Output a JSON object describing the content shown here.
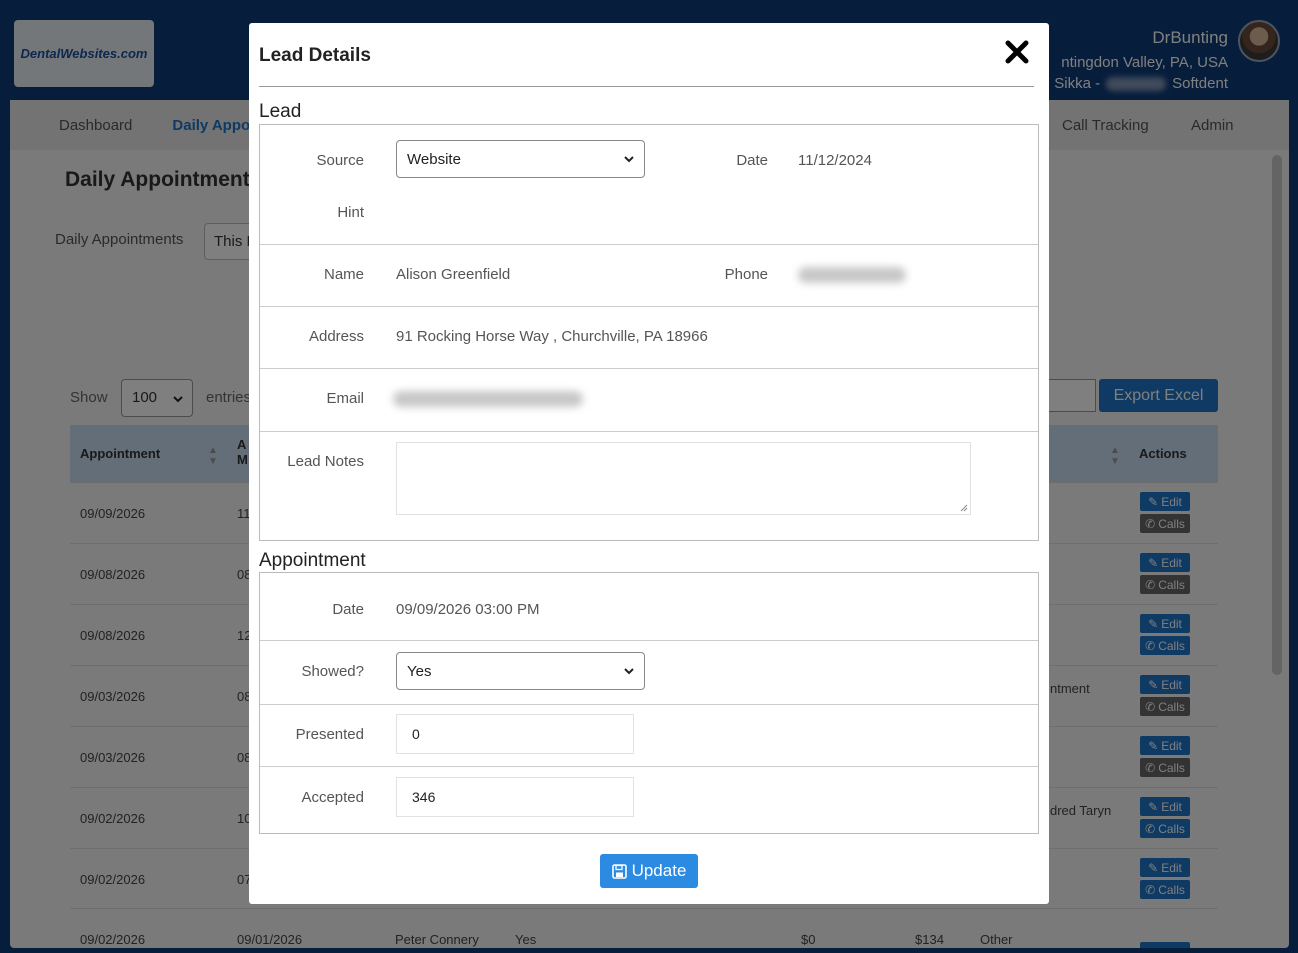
{
  "app": {
    "logo_text": "DentalWebsites.com",
    "user_name": "DrBunting",
    "user_location": "ntingdon Valley, PA, USA",
    "user_system_left": "Sikka -",
    "user_system_right": "Softdent",
    "nav": {
      "dashboard": "Dashboard",
      "daily": "Daily Appo",
      "call_tracking": "Call Tracking",
      "admin": "Admin"
    },
    "page_title": "Daily Appointments",
    "filter_label": "Daily Appointments",
    "filter_value": "This M",
    "show_label": "Show",
    "show_value": "100",
    "entries_label": "entries",
    "export_label": "Export Excel",
    "table": {
      "col_appointment": "Appointment",
      "col_am": "Ap M",
      "col_actions": "Actions",
      "edit_label": "Edit",
      "calls_label": "Calls",
      "rows": [
        {
          "date": "09/09/2026",
          "m": "11/",
          "extra": "",
          "calls_active": false
        },
        {
          "date": "09/08/2026",
          "m": "08",
          "extra": "",
          "calls_active": false
        },
        {
          "date": "09/08/2026",
          "m": "12",
          "extra": "",
          "calls_active": true
        },
        {
          "date": "09/03/2026",
          "m": "08",
          "extra": "ntment",
          "calls_active": false
        },
        {
          "date": "09/03/2026",
          "m": "08",
          "extra": "",
          "calls_active": false
        },
        {
          "date": "09/02/2026",
          "m": "10",
          "extra": "dred Taryn",
          "calls_active": true
        },
        {
          "date": "09/02/2026",
          "m": "07",
          "extra": "",
          "calls_active": true
        }
      ],
      "partial_row": {
        "date": "09/02/2026",
        "m": "09/01/2026",
        "name": "Peter Connery",
        "showed": "Yes",
        "v1": "$0",
        "v2": "$134",
        "type": "Other"
      }
    }
  },
  "modal": {
    "title": "Lead Details",
    "lead_section": "Lead",
    "appointment_section": "Appointment",
    "update_label": "Update",
    "lead": {
      "source_label": "Source",
      "source_value": "Website",
      "date_label": "Date",
      "date_value": "11/12/2024",
      "hint_label": "Hint",
      "name_label": "Name",
      "name_value": "Alison Greenfield",
      "phone_label": "Phone",
      "address_label": "Address",
      "address_value": "91 Rocking Horse Way , Churchville, PA 18966",
      "email_label": "Email",
      "notes_label": "Lead Notes"
    },
    "appointment": {
      "date_label": "Date",
      "date_value": "09/09/2026 03:00 PM",
      "showed_label": "Showed?",
      "showed_value": "Yes",
      "presented_label": "Presented",
      "presented_value": "0",
      "accepted_label": "Accepted",
      "accepted_value": "346"
    }
  }
}
